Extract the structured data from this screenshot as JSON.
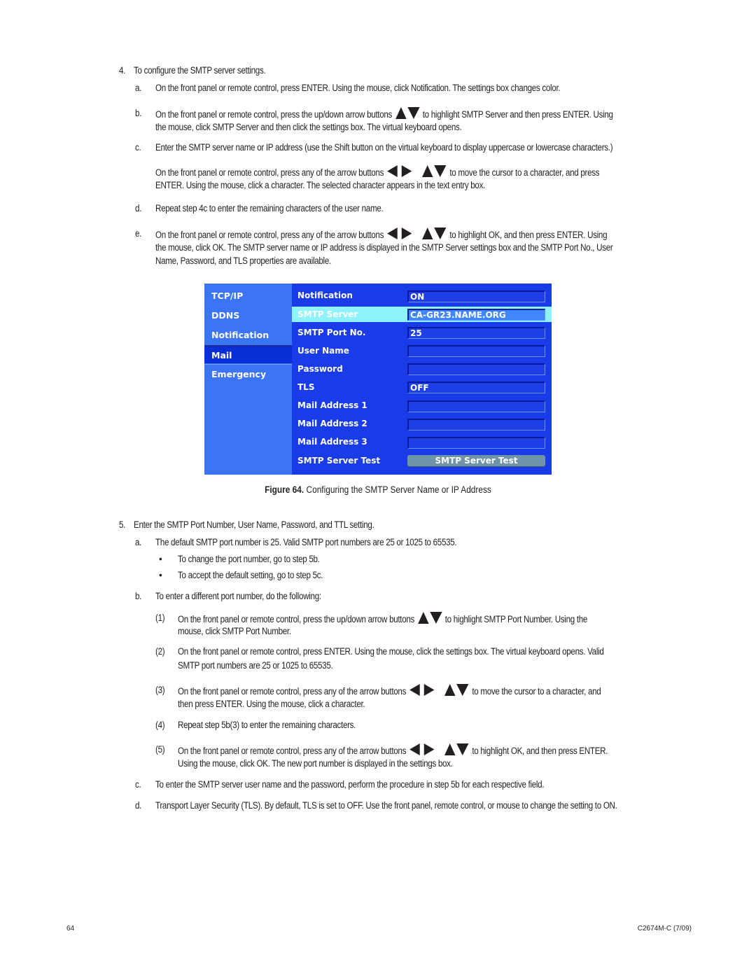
{
  "step4": {
    "num": "4.",
    "text": "To configure the SMTP server settings.",
    "a": {
      "label": "a.",
      "text": "On the front panel or remote control, press ENTER. Using the mouse, click Notification. The settings box changes color."
    },
    "b": {
      "label": "b.",
      "text_before": "On the front panel or remote control, press the up/down arrow buttons",
      "text_after": "to highlight SMTP Server and then press ENTER. Using",
      "line2": "the mouse, click SMTP Server and then click the settings box. The virtual keyboard opens."
    },
    "c": {
      "label": "c.",
      "text": "Enter the SMTP server name or IP address (use the Shift button on the virtual keyboard to display uppercase or lowercase characters.)",
      "para2_before": "On the front panel or remote control, press any of the arrow buttons",
      "para2_after": "to move the cursor to a character, and press",
      "para2_line2": "ENTER. Using the mouse, click a character. The selected character appears in the text entry box."
    },
    "d": {
      "label": "d.",
      "text": "Repeat step 4c to enter the remaining characters of the user name."
    },
    "e": {
      "label": "e.",
      "text_before": "On the front panel or remote control, press any of the arrow buttons",
      "text_after": "to highlight OK, and then press ENTER. Using",
      "line2": "the mouse, click OK. The SMTP server name or IP address is displayed in the SMTP Server settings box and the SMTP Port No., User",
      "line3": "Name, Password, and TLS properties are available."
    }
  },
  "figure": {
    "sidebar": [
      {
        "label": "TCP/IP",
        "active": false
      },
      {
        "label": "DDNS",
        "active": false
      },
      {
        "label": "Notification",
        "active": false
      },
      {
        "label": "Mail",
        "active": true
      },
      {
        "label": "Emergency",
        "active": false
      }
    ],
    "rows": [
      {
        "label": "Notification",
        "value": "ON"
      },
      {
        "label": "SMTP Server",
        "value": "CA-GR23.NAME.ORG",
        "highlighted": true
      },
      {
        "label": "SMTP Port No.",
        "value": "25"
      },
      {
        "label": "User Name",
        "value": ""
      },
      {
        "label": "Password",
        "value": ""
      },
      {
        "label": "TLS",
        "value": "OFF"
      },
      {
        "label": "Mail Address 1",
        "value": ""
      },
      {
        "label": "Mail Address 2",
        "value": ""
      },
      {
        "label": "Mail Address 3",
        "value": ""
      },
      {
        "label": "SMTP Server Test",
        "button": "SMTP Server Test"
      }
    ],
    "colors": {
      "panel": "#1a3be8",
      "sidebar": "#3b74f5",
      "highlight": "#8ff3fb",
      "active_item": "#0a2fd6",
      "test_button": "#6f95a8"
    },
    "caption_label": "Figure 64.",
    "caption_text": "Configuring the SMTP Server Name or IP Address"
  },
  "step5": {
    "num": "5.",
    "text": "Enter the SMTP Port Number, User Name, Password, and TTL setting.",
    "a": {
      "label": "a.",
      "text": "The default SMTP port number is 25. Valid SMTP port numbers are 25 or 1025 to 65535.",
      "bullets": [
        "To change the port number, go to step 5b.",
        "To accept the default setting, go to step 5c."
      ]
    },
    "b": {
      "label": "b.",
      "text": "To enter a different port number, do the following:",
      "s1": {
        "label": "(1)",
        "text_before": "On the front panel or remote control, press the up/down arrow buttons",
        "text_after": "to highlight SMTP Port Number. Using the",
        "line2": "mouse, click SMTP Port Number."
      },
      "s2": {
        "label": "(2)",
        "text": "On the front panel or remote control, press ENTER. Using the mouse, click the settings box. The virtual keyboard opens. Valid",
        "line2": "SMTP port numbers are 25 or 1025 to 65535."
      },
      "s3": {
        "label": "(3)",
        "text_before": "On the front panel or remote control, press any of the arrow buttons",
        "text_after": "to move the cursor to a character, and",
        "line2": "then press ENTER. Using the mouse, click a character."
      },
      "s4": {
        "label": "(4)",
        "text": "Repeat step 5b(3) to enter the remaining characters."
      },
      "s5": {
        "label": "(5)",
        "text_before": "On the front panel or remote control, press any of the arrow buttons",
        "text_after": "to highlight OK, and then press ENTER.",
        "line2": "Using the mouse, click OK. The new port number is displayed in the settings box."
      }
    },
    "c": {
      "label": "c.",
      "text": "To enter the SMTP server user name and the password, perform the procedure in step 5b for each respective field."
    },
    "d": {
      "label": "d.",
      "text": "Transport Layer Security (TLS). By default, TLS is set to OFF. Use the front panel, remote control, or mouse to change the setting to ON."
    }
  },
  "footer": {
    "page": "64",
    "doc_id": "C2674M-C (7/09)"
  },
  "bullet_glyph": "•"
}
